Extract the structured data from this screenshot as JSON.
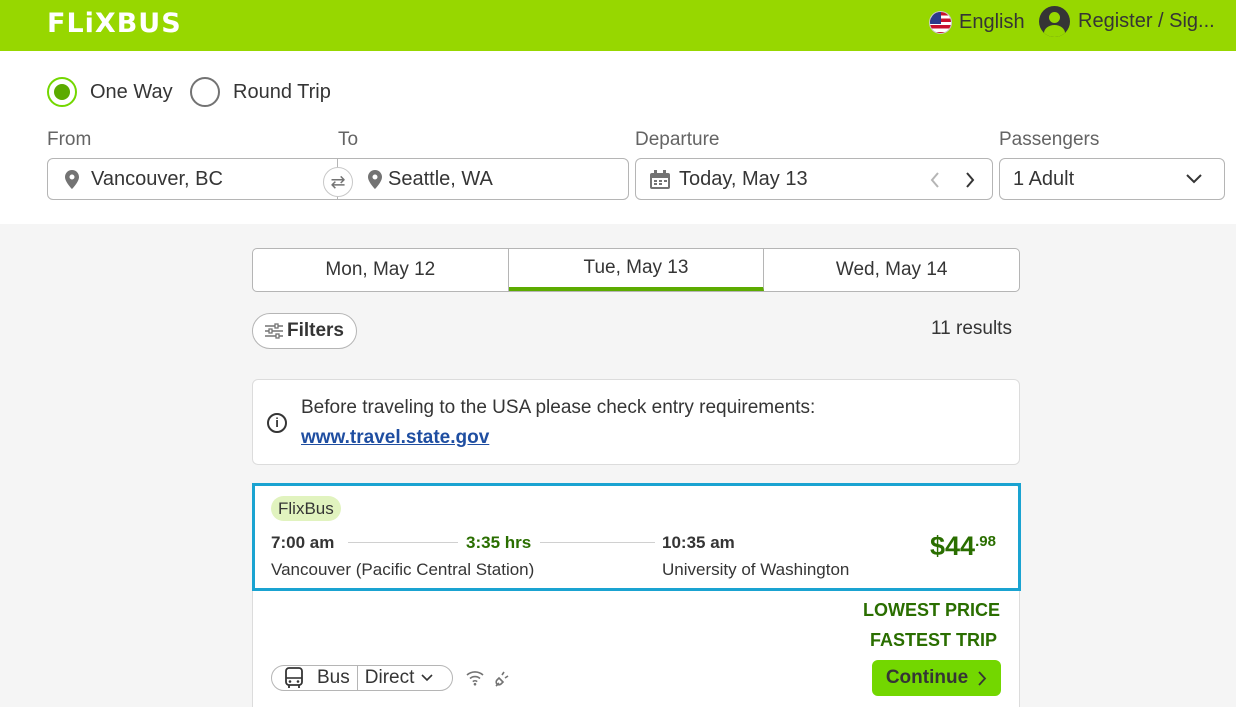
{
  "header": {
    "logo": "FLiXBUS",
    "language": "English",
    "account": "Register / Sig..."
  },
  "trip_type": {
    "one_way": "One Way",
    "round_trip": "Round Trip",
    "selected": "One Way"
  },
  "search": {
    "from_label": "From",
    "from_value": "Vancouver, BC",
    "to_label": "To",
    "to_value": "Seattle, WA",
    "departure_label": "Departure",
    "departure_value": "Today, May 13",
    "passengers_label": "Passengers",
    "passengers_value": "1 Adult"
  },
  "day_tabs": [
    {
      "label": "Mon, May 12"
    },
    {
      "label": "Tue, May 13"
    },
    {
      "label": "Wed, May 14"
    }
  ],
  "filters": {
    "label": "Filters",
    "results": "11 results"
  },
  "notice": {
    "text": "Before traveling to the USA please check entry requirements:",
    "link": "www.travel.state.gov"
  },
  "trip": {
    "operator": "FlixBus",
    "depart_time": "7:00 am",
    "duration": "3:35 hrs",
    "arrive_time": "10:35 am",
    "from_station": "Vancouver (Pacific Central Station)",
    "to_station": "University of Washington",
    "price_main": "$44",
    "price_cents": ".98",
    "tag_1": "LOWEST PRICE",
    "tag_2": "FASTEST TRIP",
    "transport": "Bus",
    "route_type": "Direct",
    "continue": "Continue"
  },
  "colors": {
    "brand": "#97d700",
    "accent_green": "#2a6e00",
    "highlight": "#1aa3d1",
    "link": "#1f4ea1"
  }
}
